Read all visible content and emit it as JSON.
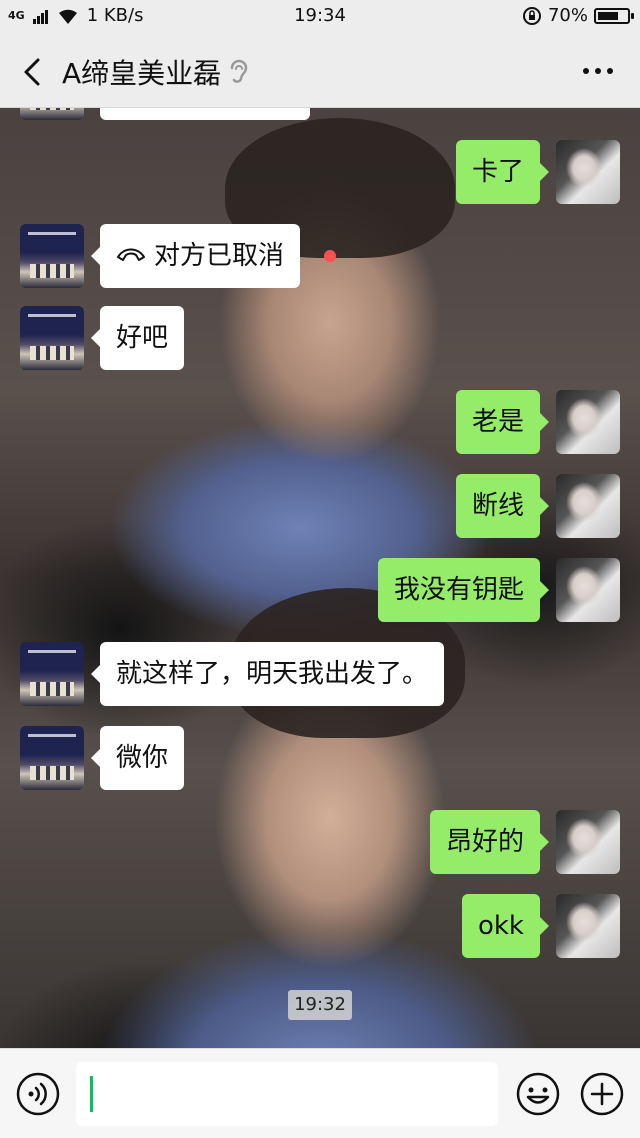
{
  "status_bar": {
    "network": "4G",
    "speed": "1 KB/s",
    "time": "19:34",
    "battery": "70%",
    "battery_level": 0.7
  },
  "header": {
    "title": "A缔皇美业磊"
  },
  "messages": [
    {
      "side": "out",
      "text": "卡了"
    },
    {
      "side": "in",
      "text": "对方已取消",
      "icon": "phone-hangup-icon"
    },
    {
      "side": "in",
      "text": "好吧"
    },
    {
      "side": "out",
      "text": "老是"
    },
    {
      "side": "out",
      "text": "断线"
    },
    {
      "side": "out",
      "text": "我没有钥匙"
    },
    {
      "side": "in",
      "text": "就这样了，明天我出发了。"
    },
    {
      "side": "in",
      "text": "微你"
    },
    {
      "side": "out",
      "text": "昂好的"
    },
    {
      "side": "out",
      "text": "okk"
    }
  ],
  "timestamp": "19:32",
  "input": {
    "value": ""
  },
  "colors": {
    "outgoing_bubble": "#95ec69",
    "incoming_bubble": "#ffffff",
    "caret": "#07c160",
    "unread_dot": "#fa5151"
  }
}
